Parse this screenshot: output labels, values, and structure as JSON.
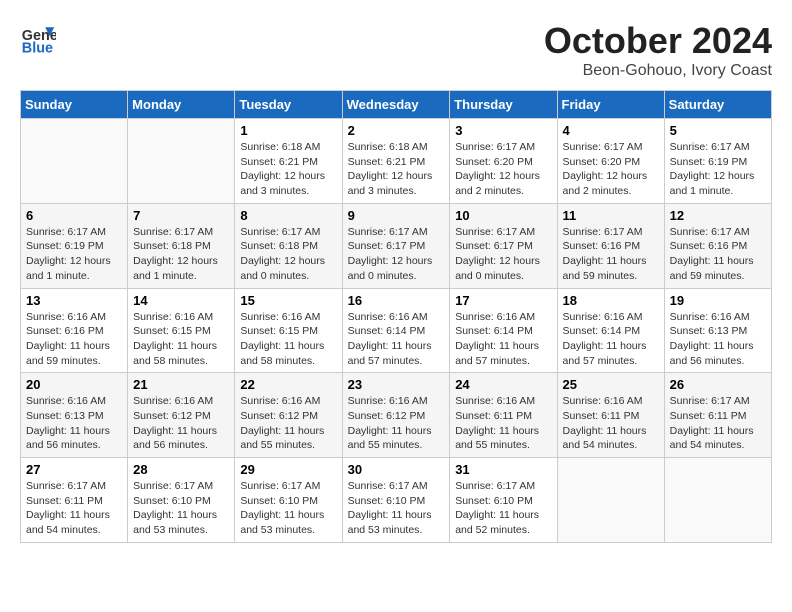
{
  "header": {
    "logo_line1": "General",
    "logo_line2": "Blue",
    "month": "October 2024",
    "location": "Beon-Gohouo, Ivory Coast"
  },
  "days_of_week": [
    "Sunday",
    "Monday",
    "Tuesday",
    "Wednesday",
    "Thursday",
    "Friday",
    "Saturday"
  ],
  "weeks": [
    [
      {
        "day": "",
        "info": ""
      },
      {
        "day": "",
        "info": ""
      },
      {
        "day": "1",
        "info": "Sunrise: 6:18 AM\nSunset: 6:21 PM\nDaylight: 12 hours and 3 minutes."
      },
      {
        "day": "2",
        "info": "Sunrise: 6:18 AM\nSunset: 6:21 PM\nDaylight: 12 hours and 3 minutes."
      },
      {
        "day": "3",
        "info": "Sunrise: 6:17 AM\nSunset: 6:20 PM\nDaylight: 12 hours and 2 minutes."
      },
      {
        "day": "4",
        "info": "Sunrise: 6:17 AM\nSunset: 6:20 PM\nDaylight: 12 hours and 2 minutes."
      },
      {
        "day": "5",
        "info": "Sunrise: 6:17 AM\nSunset: 6:19 PM\nDaylight: 12 hours and 1 minute."
      }
    ],
    [
      {
        "day": "6",
        "info": "Sunrise: 6:17 AM\nSunset: 6:19 PM\nDaylight: 12 hours and 1 minute."
      },
      {
        "day": "7",
        "info": "Sunrise: 6:17 AM\nSunset: 6:18 PM\nDaylight: 12 hours and 1 minute."
      },
      {
        "day": "8",
        "info": "Sunrise: 6:17 AM\nSunset: 6:18 PM\nDaylight: 12 hours and 0 minutes."
      },
      {
        "day": "9",
        "info": "Sunrise: 6:17 AM\nSunset: 6:17 PM\nDaylight: 12 hours and 0 minutes."
      },
      {
        "day": "10",
        "info": "Sunrise: 6:17 AM\nSunset: 6:17 PM\nDaylight: 12 hours and 0 minutes."
      },
      {
        "day": "11",
        "info": "Sunrise: 6:17 AM\nSunset: 6:16 PM\nDaylight: 11 hours and 59 minutes."
      },
      {
        "day": "12",
        "info": "Sunrise: 6:17 AM\nSunset: 6:16 PM\nDaylight: 11 hours and 59 minutes."
      }
    ],
    [
      {
        "day": "13",
        "info": "Sunrise: 6:16 AM\nSunset: 6:16 PM\nDaylight: 11 hours and 59 minutes."
      },
      {
        "day": "14",
        "info": "Sunrise: 6:16 AM\nSunset: 6:15 PM\nDaylight: 11 hours and 58 minutes."
      },
      {
        "day": "15",
        "info": "Sunrise: 6:16 AM\nSunset: 6:15 PM\nDaylight: 11 hours and 58 minutes."
      },
      {
        "day": "16",
        "info": "Sunrise: 6:16 AM\nSunset: 6:14 PM\nDaylight: 11 hours and 57 minutes."
      },
      {
        "day": "17",
        "info": "Sunrise: 6:16 AM\nSunset: 6:14 PM\nDaylight: 11 hours and 57 minutes."
      },
      {
        "day": "18",
        "info": "Sunrise: 6:16 AM\nSunset: 6:14 PM\nDaylight: 11 hours and 57 minutes."
      },
      {
        "day": "19",
        "info": "Sunrise: 6:16 AM\nSunset: 6:13 PM\nDaylight: 11 hours and 56 minutes."
      }
    ],
    [
      {
        "day": "20",
        "info": "Sunrise: 6:16 AM\nSunset: 6:13 PM\nDaylight: 11 hours and 56 minutes."
      },
      {
        "day": "21",
        "info": "Sunrise: 6:16 AM\nSunset: 6:12 PM\nDaylight: 11 hours and 56 minutes."
      },
      {
        "day": "22",
        "info": "Sunrise: 6:16 AM\nSunset: 6:12 PM\nDaylight: 11 hours and 55 minutes."
      },
      {
        "day": "23",
        "info": "Sunrise: 6:16 AM\nSunset: 6:12 PM\nDaylight: 11 hours and 55 minutes."
      },
      {
        "day": "24",
        "info": "Sunrise: 6:16 AM\nSunset: 6:11 PM\nDaylight: 11 hours and 55 minutes."
      },
      {
        "day": "25",
        "info": "Sunrise: 6:16 AM\nSunset: 6:11 PM\nDaylight: 11 hours and 54 minutes."
      },
      {
        "day": "26",
        "info": "Sunrise: 6:17 AM\nSunset: 6:11 PM\nDaylight: 11 hours and 54 minutes."
      }
    ],
    [
      {
        "day": "27",
        "info": "Sunrise: 6:17 AM\nSunset: 6:11 PM\nDaylight: 11 hours and 54 minutes."
      },
      {
        "day": "28",
        "info": "Sunrise: 6:17 AM\nSunset: 6:10 PM\nDaylight: 11 hours and 53 minutes."
      },
      {
        "day": "29",
        "info": "Sunrise: 6:17 AM\nSunset: 6:10 PM\nDaylight: 11 hours and 53 minutes."
      },
      {
        "day": "30",
        "info": "Sunrise: 6:17 AM\nSunset: 6:10 PM\nDaylight: 11 hours and 53 minutes."
      },
      {
        "day": "31",
        "info": "Sunrise: 6:17 AM\nSunset: 6:10 PM\nDaylight: 11 hours and 52 minutes."
      },
      {
        "day": "",
        "info": ""
      },
      {
        "day": "",
        "info": ""
      }
    ]
  ]
}
